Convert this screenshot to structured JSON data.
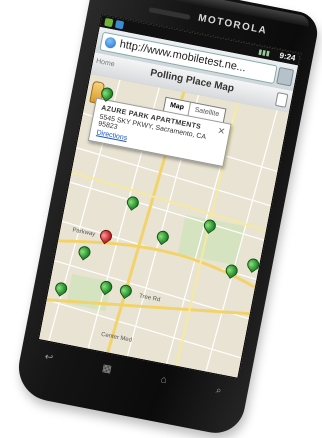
{
  "device": {
    "brand": "MOTOROLA"
  },
  "status_bar": {
    "time": "9:24"
  },
  "browser": {
    "url": "http://www.mobiletest.ne..."
  },
  "page": {
    "title": "Polling Place Map",
    "back_label": "Home"
  },
  "map": {
    "map_type": {
      "map_label": "Map",
      "satellite_label": "Satellite"
    },
    "info_window": {
      "name": "AZURE PARK APARTMENTS",
      "address": "5545 SKY PKWY, Sacramento, CA 95823",
      "link": "Directions",
      "close": "✕"
    },
    "pin_colors": {
      "polling_place": "#1f8b2a",
      "current_location": "#c02020"
    }
  },
  "nav_keys": [
    "back",
    "menu",
    "home",
    "search"
  ]
}
